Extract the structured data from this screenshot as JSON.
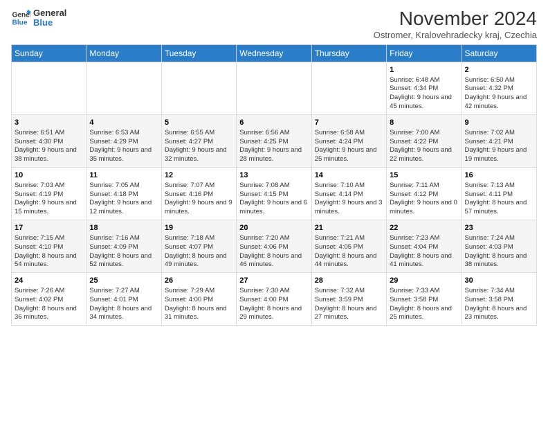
{
  "logo": {
    "line1": "General",
    "line2": "Blue"
  },
  "title": "November 2024",
  "subtitle": "Ostromer, Kralovehradecky kraj, Czechia",
  "weekdays": [
    "Sunday",
    "Monday",
    "Tuesday",
    "Wednesday",
    "Thursday",
    "Friday",
    "Saturday"
  ],
  "weeks": [
    [
      {
        "day": "",
        "info": ""
      },
      {
        "day": "",
        "info": ""
      },
      {
        "day": "",
        "info": ""
      },
      {
        "day": "",
        "info": ""
      },
      {
        "day": "",
        "info": ""
      },
      {
        "day": "1",
        "info": "Sunrise: 6:48 AM\nSunset: 4:34 PM\nDaylight: 9 hours and 45 minutes."
      },
      {
        "day": "2",
        "info": "Sunrise: 6:50 AM\nSunset: 4:32 PM\nDaylight: 9 hours and 42 minutes."
      }
    ],
    [
      {
        "day": "3",
        "info": "Sunrise: 6:51 AM\nSunset: 4:30 PM\nDaylight: 9 hours and 38 minutes."
      },
      {
        "day": "4",
        "info": "Sunrise: 6:53 AM\nSunset: 4:29 PM\nDaylight: 9 hours and 35 minutes."
      },
      {
        "day": "5",
        "info": "Sunrise: 6:55 AM\nSunset: 4:27 PM\nDaylight: 9 hours and 32 minutes."
      },
      {
        "day": "6",
        "info": "Sunrise: 6:56 AM\nSunset: 4:25 PM\nDaylight: 9 hours and 28 minutes."
      },
      {
        "day": "7",
        "info": "Sunrise: 6:58 AM\nSunset: 4:24 PM\nDaylight: 9 hours and 25 minutes."
      },
      {
        "day": "8",
        "info": "Sunrise: 7:00 AM\nSunset: 4:22 PM\nDaylight: 9 hours and 22 minutes."
      },
      {
        "day": "9",
        "info": "Sunrise: 7:02 AM\nSunset: 4:21 PM\nDaylight: 9 hours and 19 minutes."
      }
    ],
    [
      {
        "day": "10",
        "info": "Sunrise: 7:03 AM\nSunset: 4:19 PM\nDaylight: 9 hours and 15 minutes."
      },
      {
        "day": "11",
        "info": "Sunrise: 7:05 AM\nSunset: 4:18 PM\nDaylight: 9 hours and 12 minutes."
      },
      {
        "day": "12",
        "info": "Sunrise: 7:07 AM\nSunset: 4:16 PM\nDaylight: 9 hours and 9 minutes."
      },
      {
        "day": "13",
        "info": "Sunrise: 7:08 AM\nSunset: 4:15 PM\nDaylight: 9 hours and 6 minutes."
      },
      {
        "day": "14",
        "info": "Sunrise: 7:10 AM\nSunset: 4:14 PM\nDaylight: 9 hours and 3 minutes."
      },
      {
        "day": "15",
        "info": "Sunrise: 7:11 AM\nSunset: 4:12 PM\nDaylight: 9 hours and 0 minutes."
      },
      {
        "day": "16",
        "info": "Sunrise: 7:13 AM\nSunset: 4:11 PM\nDaylight: 8 hours and 57 minutes."
      }
    ],
    [
      {
        "day": "17",
        "info": "Sunrise: 7:15 AM\nSunset: 4:10 PM\nDaylight: 8 hours and 54 minutes."
      },
      {
        "day": "18",
        "info": "Sunrise: 7:16 AM\nSunset: 4:09 PM\nDaylight: 8 hours and 52 minutes."
      },
      {
        "day": "19",
        "info": "Sunrise: 7:18 AM\nSunset: 4:07 PM\nDaylight: 8 hours and 49 minutes."
      },
      {
        "day": "20",
        "info": "Sunrise: 7:20 AM\nSunset: 4:06 PM\nDaylight: 8 hours and 46 minutes."
      },
      {
        "day": "21",
        "info": "Sunrise: 7:21 AM\nSunset: 4:05 PM\nDaylight: 8 hours and 44 minutes."
      },
      {
        "day": "22",
        "info": "Sunrise: 7:23 AM\nSunset: 4:04 PM\nDaylight: 8 hours and 41 minutes."
      },
      {
        "day": "23",
        "info": "Sunrise: 7:24 AM\nSunset: 4:03 PM\nDaylight: 8 hours and 38 minutes."
      }
    ],
    [
      {
        "day": "24",
        "info": "Sunrise: 7:26 AM\nSunset: 4:02 PM\nDaylight: 8 hours and 36 minutes."
      },
      {
        "day": "25",
        "info": "Sunrise: 7:27 AM\nSunset: 4:01 PM\nDaylight: 8 hours and 34 minutes."
      },
      {
        "day": "26",
        "info": "Sunrise: 7:29 AM\nSunset: 4:00 PM\nDaylight: 8 hours and 31 minutes."
      },
      {
        "day": "27",
        "info": "Sunrise: 7:30 AM\nSunset: 4:00 PM\nDaylight: 8 hours and 29 minutes."
      },
      {
        "day": "28",
        "info": "Sunrise: 7:32 AM\nSunset: 3:59 PM\nDaylight: 8 hours and 27 minutes."
      },
      {
        "day": "29",
        "info": "Sunrise: 7:33 AM\nSunset: 3:58 PM\nDaylight: 8 hours and 25 minutes."
      },
      {
        "day": "30",
        "info": "Sunrise: 7:34 AM\nSunset: 3:58 PM\nDaylight: 8 hours and 23 minutes."
      }
    ]
  ]
}
